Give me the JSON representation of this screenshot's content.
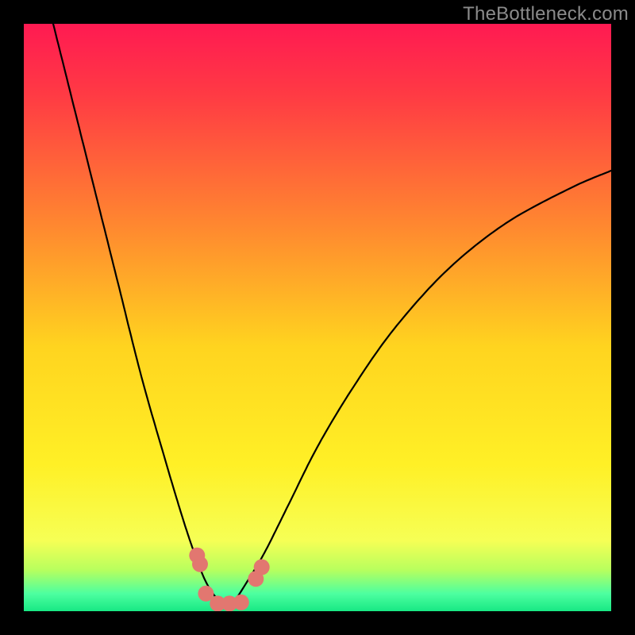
{
  "watermark": "TheBottleneck.com",
  "colors": {
    "frame": "#000000",
    "gradient_stops": [
      {
        "offset": 0.0,
        "color": "#ff1a52"
      },
      {
        "offset": 0.12,
        "color": "#ff3a44"
      },
      {
        "offset": 0.35,
        "color": "#ff8a2f"
      },
      {
        "offset": 0.55,
        "color": "#ffd41f"
      },
      {
        "offset": 0.75,
        "color": "#fff026"
      },
      {
        "offset": 0.88,
        "color": "#f6ff55"
      },
      {
        "offset": 0.93,
        "color": "#b7ff5e"
      },
      {
        "offset": 0.97,
        "color": "#4dffa0"
      },
      {
        "offset": 1.0,
        "color": "#18e884"
      }
    ],
    "curve": "#000000",
    "marker_fill": "#e27770",
    "marker_stroke": "#d4665f"
  },
  "chart_data": {
    "type": "line",
    "title": "",
    "xlabel": "",
    "ylabel": "",
    "xlim": [
      0,
      100
    ],
    "ylim": [
      0,
      100
    ],
    "series": [
      {
        "name": "bottleneck-curve",
        "x": [
          5,
          8,
          12,
          16,
          20,
          24,
          27,
          29,
          31,
          33,
          34.5,
          36,
          38,
          41,
          45,
          50,
          56,
          63,
          72,
          82,
          93,
          100
        ],
        "y": [
          100,
          88,
          72,
          56,
          40,
          26,
          16,
          10,
          5,
          2,
          1,
          2,
          5,
          10,
          18,
          28,
          38,
          48,
          58,
          66,
          72,
          75
        ]
      }
    ],
    "markers": {
      "name": "highlight-cluster",
      "points": [
        {
          "x": 29.5,
          "y": 9.5
        },
        {
          "x": 30.0,
          "y": 8.0
        },
        {
          "x": 31.0,
          "y": 3.0
        },
        {
          "x": 33.0,
          "y": 1.3
        },
        {
          "x": 35.0,
          "y": 1.3
        },
        {
          "x": 37.0,
          "y": 1.5
        },
        {
          "x": 39.5,
          "y": 5.5
        },
        {
          "x": 40.5,
          "y": 7.5
        }
      ],
      "radius": 10
    }
  }
}
